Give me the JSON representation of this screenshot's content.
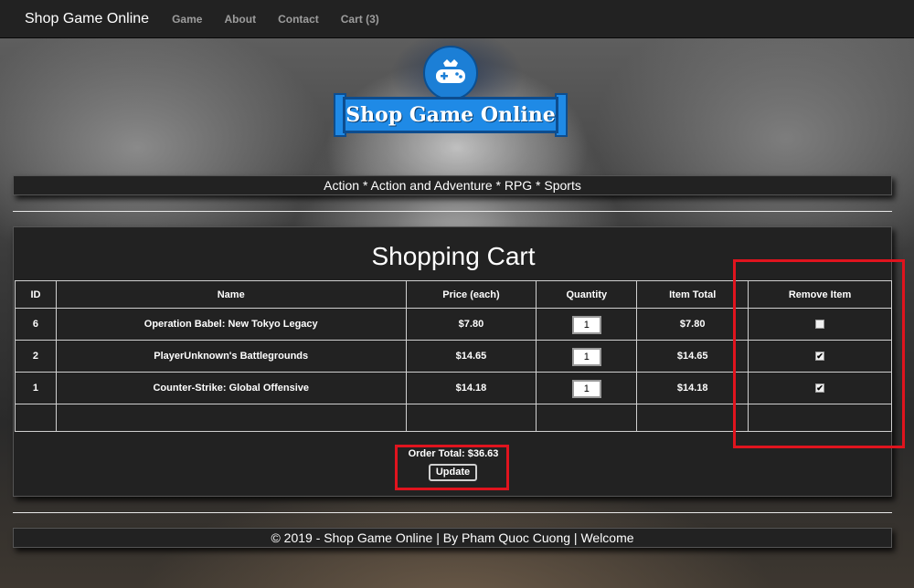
{
  "navbar": {
    "brand": "Shop Game Online",
    "links": [
      "Game",
      "About",
      "Contact",
      "Cart (3)"
    ]
  },
  "logo": {
    "text": "Shop Game Online"
  },
  "categories": "Action * Action and Adventure * RPG * Sports",
  "cart": {
    "title": "Shopping Cart",
    "headers": [
      "ID",
      "Name",
      "Price (each)",
      "Quantity",
      "Item Total",
      "Remove Item"
    ],
    "rows": [
      {
        "id": "6",
        "name": "Operation Babel: New Tokyo Legacy",
        "price": "$7.80",
        "quantity": "1",
        "total": "$7.80",
        "remove": false
      },
      {
        "id": "2",
        "name": "PlayerUnknown's Battlegrounds",
        "price": "$14.65",
        "quantity": "1",
        "total": "$14.65",
        "remove": true
      },
      {
        "id": "1",
        "name": "Counter-Strike: Global Offensive",
        "price": "$14.18",
        "quantity": "1",
        "total": "$14.18",
        "remove": true
      }
    ],
    "order_total": "Order Total: $36.63",
    "update_label": "Update"
  },
  "footer": "© 2019 - Shop Game Online | By Pham Quoc Cuong | Welcome",
  "colors": {
    "navbar": "#222222",
    "highlight": "#e0141e",
    "logo_blue": "#1f8ae6"
  }
}
